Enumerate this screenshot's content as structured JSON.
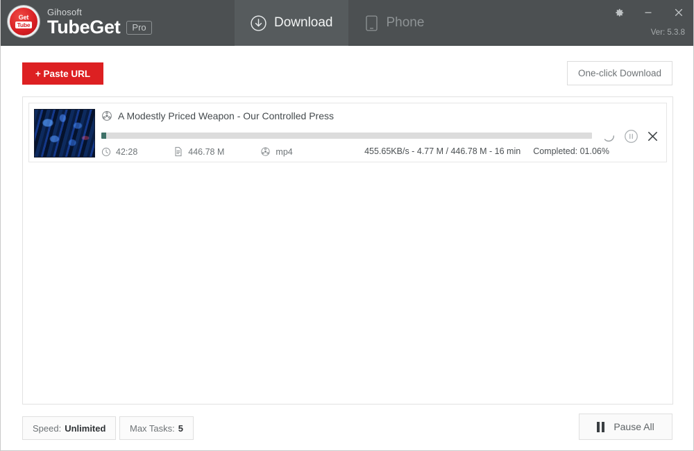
{
  "window": {
    "company": "Gihosoft",
    "product": "TubeGet",
    "edition": "Pro",
    "version": "Ver: 5.3.8",
    "logo_top": "Get",
    "logo_bottom": "Tube"
  },
  "tabs": [
    {
      "id": "download",
      "label": "Download",
      "icon": "download-circle-icon",
      "active": true
    },
    {
      "id": "phone",
      "label": "Phone",
      "icon": "phone-icon",
      "active": false
    }
  ],
  "window_controls": [
    {
      "id": "settings",
      "icon": "gear-icon"
    },
    {
      "id": "minimize",
      "icon": "minimize-icon"
    },
    {
      "id": "close",
      "icon": "close-icon"
    }
  ],
  "toolbar": {
    "paste_url_label": "+ Paste URL",
    "one_click_label": "One-click Download",
    "accent_color": "#dd2022"
  },
  "tasks": [
    {
      "title": "A Modestly Priced Weapon - Our Controlled Press",
      "title_icon": "film-reel-icon",
      "duration": "42:28",
      "size": "446.78 M",
      "format": "mp4",
      "duration_icon": "clock-icon",
      "size_icon": "file-icon",
      "format_icon": "film-reel-icon",
      "transfer": "455.65KB/s - 4.77 M / 446.78 M - 16 min",
      "completed": "Completed: 01.06%",
      "progress_percent": 1.06,
      "progress_color": "#3f7168",
      "actions": [
        {
          "id": "loading",
          "icon": "spinner-icon"
        },
        {
          "id": "pause",
          "icon": "pause-circle-icon"
        },
        {
          "id": "remove",
          "icon": "close-icon"
        }
      ]
    }
  ],
  "bottom": {
    "speed_label": "Speed:",
    "speed_value": "Unlimited",
    "tasks_label": "Max Tasks:",
    "tasks_value": "5",
    "pause_all_label": "Pause All",
    "pause_all_icon": "pause-icon"
  }
}
